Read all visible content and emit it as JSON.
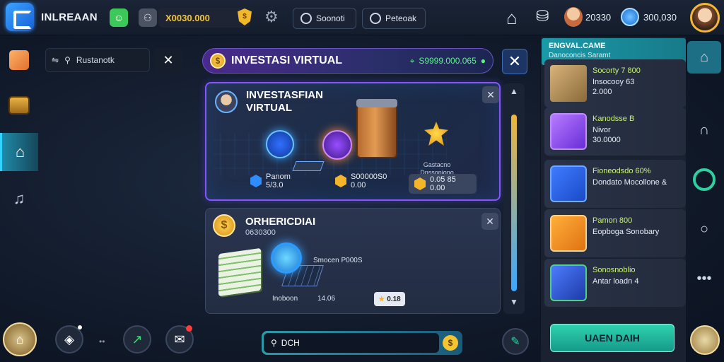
{
  "header": {
    "app_title": "INLREAAN",
    "gold_amount": "X0030.000",
    "tabs": [
      {
        "label": "Soonoti",
        "icon": "circle-icon"
      },
      {
        "label": "Peteoak",
        "icon": "circle-icon"
      }
    ],
    "stat_1": "20330",
    "stat_2": "300,030"
  },
  "search": {
    "placeholder": "Rustanotk"
  },
  "main": {
    "title": "INVESTASI VIRTUAL",
    "balance": "S9999.000.065"
  },
  "card_investment": {
    "title": "INVESTASFIAN VIRTUAL",
    "note": "Gastacno Dnssoniono",
    "stats": [
      {
        "label": "Panom",
        "value": "5/3.0"
      },
      {
        "label": "S00000S0",
        "value": "0.00"
      },
      {
        "label": "0.05 85",
        "value": "0.00"
      }
    ]
  },
  "card_other": {
    "title": "ORHERICDIAI",
    "subtitle": "0630300",
    "label_a": "Smocen P000S",
    "label_b": "Inoboon",
    "label_c": "14.06",
    "pill": "0.18"
  },
  "right_panel": {
    "header_title": "ENGVAL.CAME",
    "header_sub": "Danoconcis Saramt",
    "items": [
      {
        "title": "Socorty 7 800",
        "line1": "Insocooy 63",
        "line2": "2.000",
        "thumb": "money-stack-icon"
      },
      {
        "title": "Kanodsse B",
        "line1": "Nivor",
        "line2": "30.0000",
        "thumb": "cube-icon"
      },
      {
        "title": "Fioneodsdo 60%",
        "line1": "Dondato Mocollone &",
        "line2": "",
        "thumb": "box-icon"
      },
      {
        "title": "Pamon 800",
        "line1": "Eopboga Sonobary",
        "line2": "",
        "thumb": "tablet-icon"
      },
      {
        "title": "Sonosnoblio",
        "line1": "Antar loadn 4",
        "line2": "",
        "thumb": "cube-icon"
      }
    ],
    "main_button": "UAEN DAIH"
  },
  "bottom": {
    "search_value": "DCH"
  },
  "colors": {
    "accent_purple": "#8454ff",
    "accent_teal": "#2fd2b0",
    "gold": "#f4c431"
  }
}
